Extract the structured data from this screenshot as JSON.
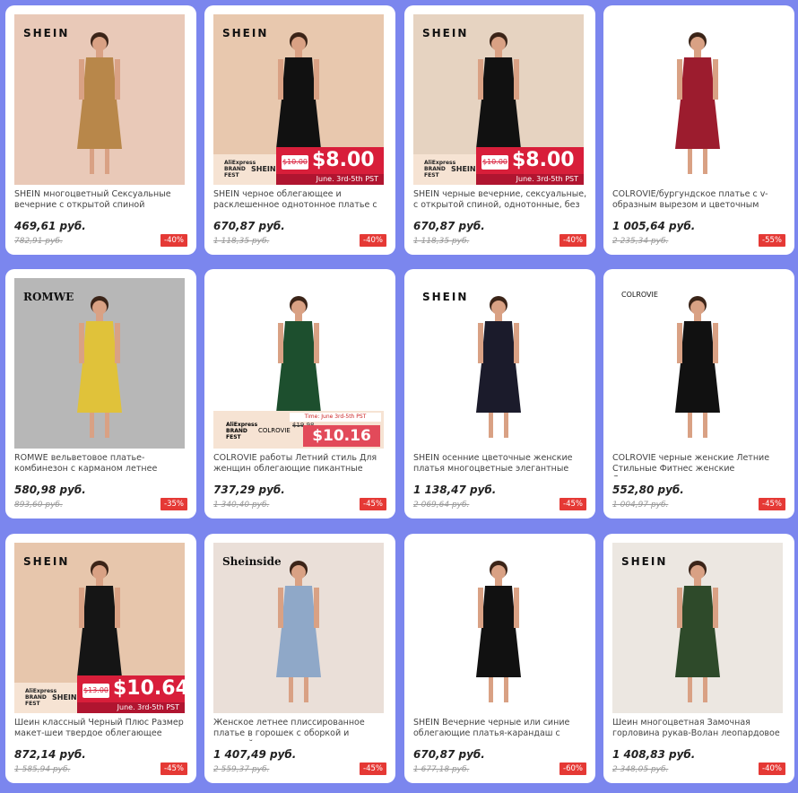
{
  "products": [
    {
      "brand": "SHEIN",
      "title": "SHEIN многоцветный Сексуальные вечерние с открытой спиной",
      "price": "469,61 руб.",
      "old_price": "782,91 руб.",
      "discount": "-40%",
      "bg": "#e9c9b8",
      "dress": "#b8874a",
      "promo": null
    },
    {
      "brand": "SHEIN",
      "title": "SHEIN черное облегающее и расклешенное однотонное платье с",
      "price": "670,87 руб.",
      "old_price": "1 118,35 руб.",
      "discount": "-40%",
      "bg": "#e8c8ae",
      "dress": "#111111",
      "promo": {
        "old": "$10.00",
        "new": "$8.00",
        "date": "June. 3rd-5th PST",
        "left1": "AliExpress",
        "left2": "BRAND",
        "left3": "FEST",
        "left_brand": "SHEIN"
      }
    },
    {
      "brand": "SHEIN",
      "title": "SHEIN черные вечерние, сексуальные, с открытой спиной, однотонные, без",
      "price": "670,87 руб.",
      "old_price": "1 118,35 руб.",
      "discount": "-40%",
      "bg": "#e6d3c1",
      "dress": "#111111",
      "promo": {
        "old": "$10.00",
        "new": "$8.00",
        "date": "June. 3rd-5th PST",
        "left1": "AliExpress",
        "left2": "BRAND",
        "left3": "FEST",
        "left_brand": "SHEIN"
      }
    },
    {
      "brand": "",
      "title": "COLROVIE/бургундское платье с v-образным вырезом и цветочным",
      "price": "1 005,64 руб.",
      "old_price": "2 235,34 руб.",
      "discount": "-55%",
      "bg": "#ffffff",
      "dress": "#9c1c2e",
      "promo": null
    },
    {
      "brand": "ROMWE",
      "title": "ROMWE вельветовое платье-комбинезон с карманом летнее желтое",
      "price": "580,98 руб.",
      "old_price": "893,60 руб.",
      "discount": "-35%",
      "bg": "#b7b7b7",
      "dress": "#e0c23a",
      "promo": null
    },
    {
      "brand": "",
      "title": "COLROVIE работы Летний стиль Для женщин облегающие пикантные платья",
      "price": "737,29 руб.",
      "old_price": "1 340,40 руб.",
      "discount": "-45%",
      "bg": "#ffffff",
      "dress": "#1d4f2e",
      "promo2": {
        "tag": "Time: June 3rd-5th PST",
        "old": "$19.98",
        "new": "$10.16",
        "left1": "AliExpress",
        "left2": "BRAND",
        "left3": "FEST",
        "left_brand": "COLROVIE"
      }
    },
    {
      "brand": "SHEIN",
      "title": "SHEIN осенние цветочные женские платья многоцветные элегантные",
      "price": "1 138,47 руб.",
      "old_price": "2 069,64 руб.",
      "discount": "-45%",
      "bg": "#ffffff",
      "dress": "#1b1b2b",
      "promo": null
    },
    {
      "brand": "COLROVIE",
      "title": "COLROVIE черные женские Летние Стильные Фитнес женские Сексуальные",
      "price": "552,80 руб.",
      "old_price": "1 004,97 руб.",
      "discount": "-45%",
      "bg": "#ffffff",
      "dress": "#111111",
      "promo": null
    },
    {
      "brand": "SHEIN",
      "title": "Шеин классный Черный Плюс Размер макет-шеи твердое облегающее платье-",
      "price": "872,14 руб.",
      "old_price": "1 585,94 руб.",
      "discount": "-45%",
      "bg": "#e7c6ac",
      "dress": "#151515",
      "promo": {
        "old": "$13.00",
        "new": "$10.64",
        "date": "June. 3rd-5th PST",
        "left1": "AliExpress",
        "left2": "BRAND",
        "left3": "FEST",
        "left_brand": "SHEIN"
      }
    },
    {
      "brand": "Sheinside",
      "title": "Женское летнее плиссированное платье в горошек с оборкой и завязкой на шее,",
      "price": "1 407,49 руб.",
      "old_price": "2 559,37 руб.",
      "discount": "-45%",
      "bg": "#eadfd8",
      "dress": "#8fa8c8",
      "promo": null
    },
    {
      "brand": "",
      "title": "SHEIN Вечерние черные или синие облегающие платья-карандаш с",
      "price": "670,87 руб.",
      "old_price": "1 677,18 руб.",
      "discount": "-60%",
      "bg": "#ffffff",
      "dress": "#111111",
      "promo": null
    },
    {
      "brand": "SHEIN",
      "title": "Шеин многоцветная Замочная горловина рукав-Волан леопардовое",
      "price": "1 408,83 руб.",
      "old_price": "2 348,05 руб.",
      "discount": "-40%",
      "bg": "#ece7e1",
      "dress": "#2e4a2a",
      "promo": null
    }
  ]
}
